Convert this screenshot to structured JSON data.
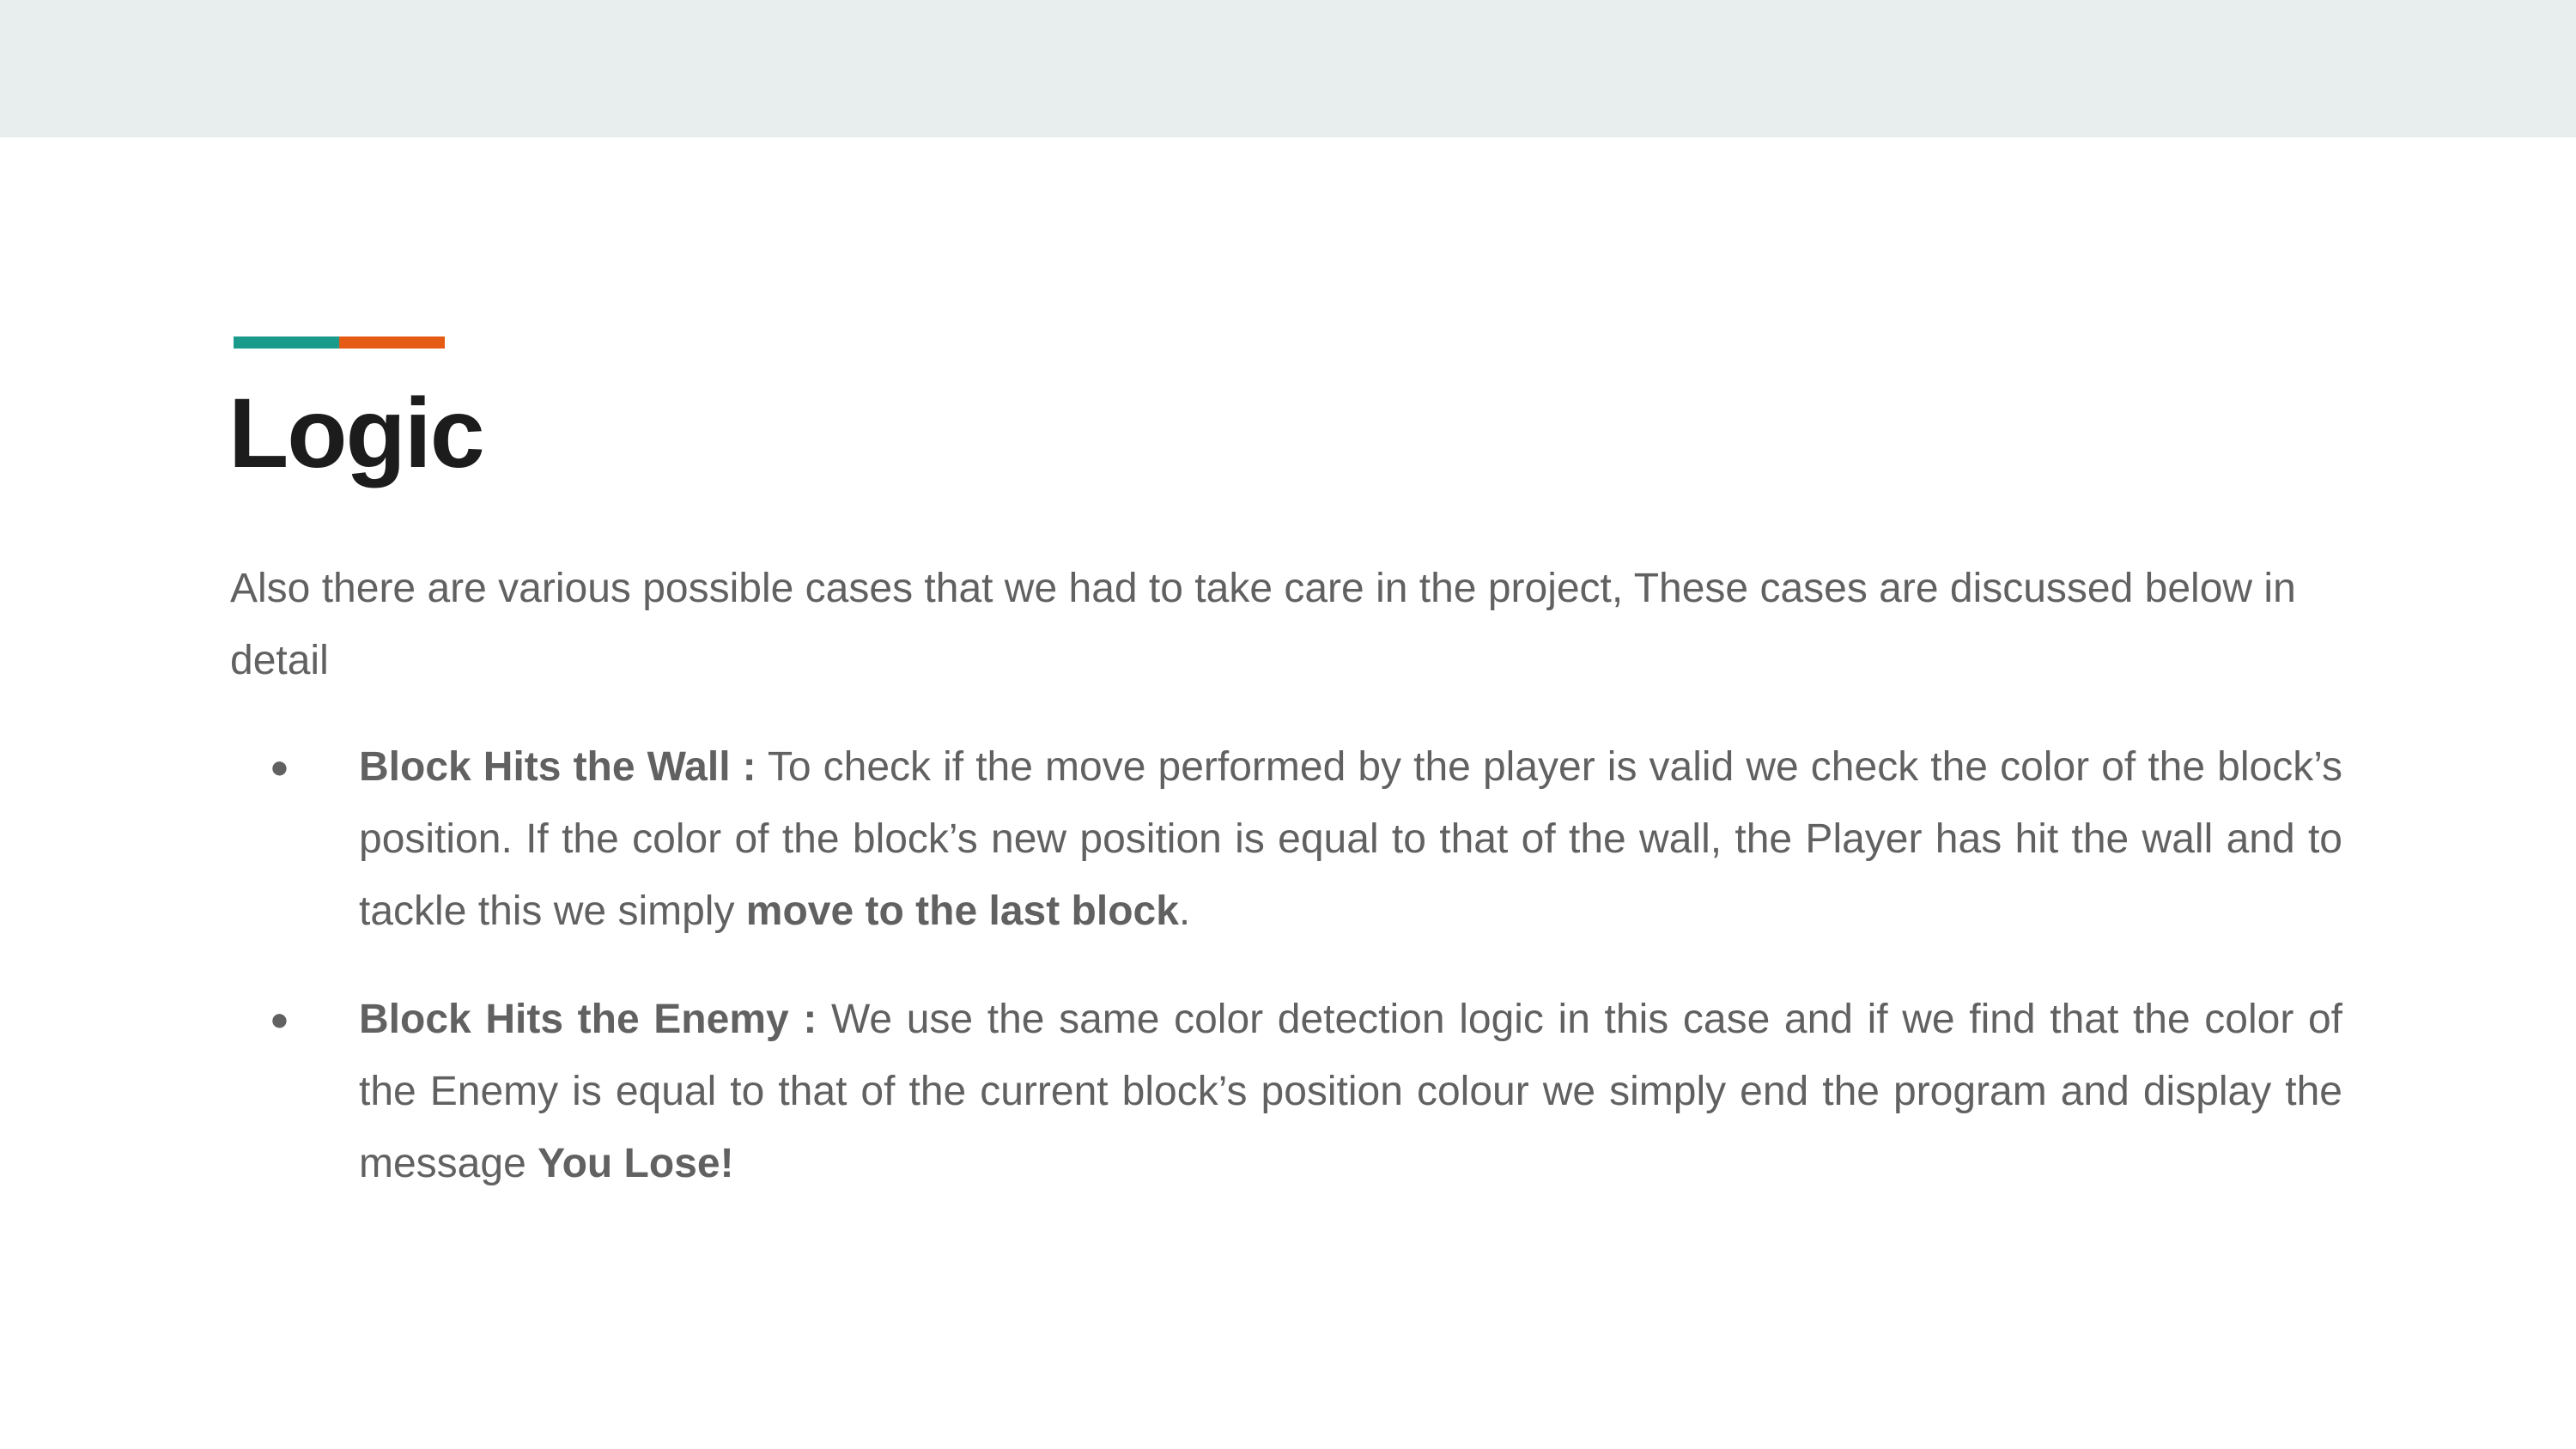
{
  "colors": {
    "top_band": "#e8eeee",
    "accent_teal": "#1a9a8a",
    "accent_orange": "#e55b13",
    "title": "#1c1c1c",
    "body_text": "#616161"
  },
  "slide": {
    "title": "Logic",
    "intro": "Also there are various possible cases that we had to take care in the project, These cases are discussed below in detail",
    "bullets": [
      {
        "marker": "●",
        "heading": "Block Hits the Wall :",
        "text": " To check if the move performed by the player is valid we check the color of the block’s position. If the color of the block’s new position is equal to that of the wall, the Player has hit the wall and to tackle this we simply ",
        "emphasis": "move to the last block",
        "tail": "."
      },
      {
        "marker": "●",
        "heading": "Block Hits the Enemy :",
        "text": " We use the same color detection logic in this case and if we find that the color of the Enemy is equal to that of the current block’s position colour we simply end the program and display the message ",
        "emphasis": "You Lose!",
        "tail": ""
      }
    ]
  }
}
